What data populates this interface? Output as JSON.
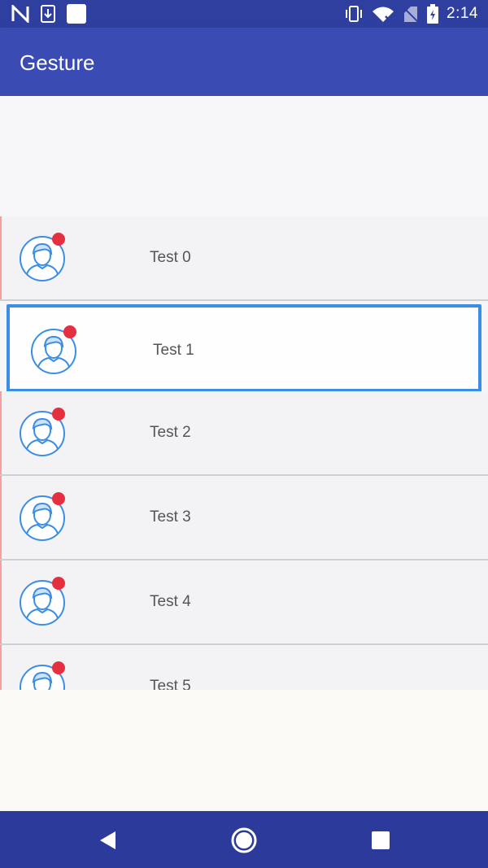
{
  "status_bar": {
    "time": "2:14",
    "icons_left": [
      "n-icon",
      "download-icon",
      "square-icon"
    ],
    "icons_right": [
      "vibrate-icon",
      "wifi-icon",
      "no-sim-icon",
      "battery-icon"
    ]
  },
  "app_bar": {
    "title": "Gesture",
    "color": "#3a4bb3"
  },
  "list": {
    "items": [
      {
        "label": "Test 0",
        "selected": false
      },
      {
        "label": "Test 1",
        "selected": true
      },
      {
        "label": "Test 2",
        "selected": false
      },
      {
        "label": "Test 3",
        "selected": false
      },
      {
        "label": "Test 4",
        "selected": false
      },
      {
        "label": "Test 5",
        "selected": false
      }
    ],
    "avatar_icon": "user-avatar-icon",
    "badge_color": "#e53040",
    "selection_color": "#3b8ee4"
  },
  "nav_bar": {
    "buttons": [
      "back-icon",
      "home-icon",
      "recents-icon"
    ]
  }
}
